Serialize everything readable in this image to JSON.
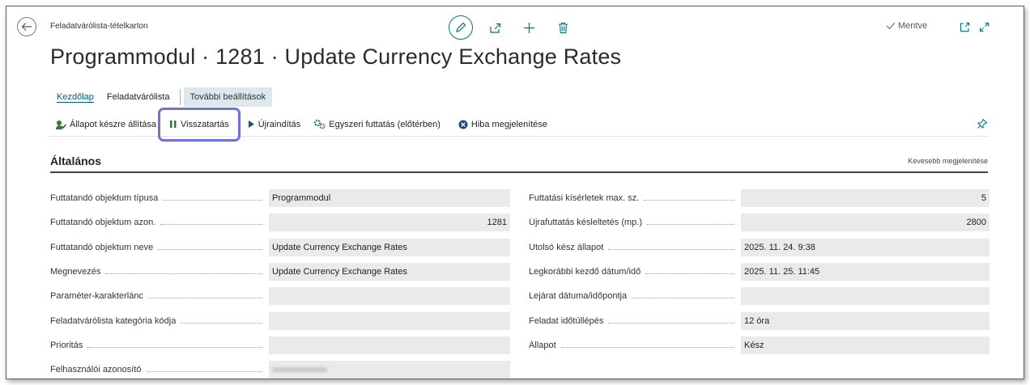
{
  "breadcrumb": "Feladatvárólista-tételkarton",
  "saved_label": "Mentve",
  "title": "Programmodul · 1281 · Update Currency Exchange Rates",
  "tabs": {
    "home": "Kezdőlap",
    "queue": "Feladatvárólista",
    "more": "További beállítások"
  },
  "actions": {
    "set_ready": "Állapot készre állítása",
    "hold": "Visszatartás",
    "restart": "Újraindítás",
    "run_once": "Egyszeri futtatás (előtérben)",
    "show_error": "Hiba megjelenítése"
  },
  "section": {
    "title": "Általános",
    "less": "Kevesebb megjelenítése"
  },
  "left_fields": [
    {
      "label": "Futtatandó objektum típusa",
      "value": "Programmodul"
    },
    {
      "label": "Futtatandó objektum azon.",
      "value": "1281"
    },
    {
      "label": "Futtatandó objektum neve",
      "value": "Update Currency Exchange Rates"
    },
    {
      "label": "Megnevezés",
      "value": "Update Currency Exchange Rates"
    },
    {
      "label": "Paraméter-karakterlánc",
      "value": ""
    },
    {
      "label": "Feladatvárólista kategória kódja",
      "value": ""
    },
    {
      "label": "Prioritás",
      "value": ""
    },
    {
      "label": "Felhasználói azonosító",
      "value": ""
    }
  ],
  "right_fields": [
    {
      "label": "Futtatási kísérletek max. sz.",
      "value": "5"
    },
    {
      "label": "Újrafuttatás késleltetés (mp.)",
      "value": "2800"
    },
    {
      "label": "Utolsó kész állapot",
      "value": "2025. 11. 24. 9:38"
    },
    {
      "label": "Legkorábbi kezdő dátum/idő",
      "value": "2025. 11. 25. 11:45"
    },
    {
      "label": "Lejárat dátuma/időpontja",
      "value": ""
    },
    {
      "label": "Feladat időtúllépés",
      "value": "12 óra"
    },
    {
      "label": "Állapot",
      "value": "Kész"
    }
  ],
  "colors": {
    "accent": "#00787a",
    "highlight_outline": "#6f6fe6",
    "field_bg": "#eaeaea"
  }
}
